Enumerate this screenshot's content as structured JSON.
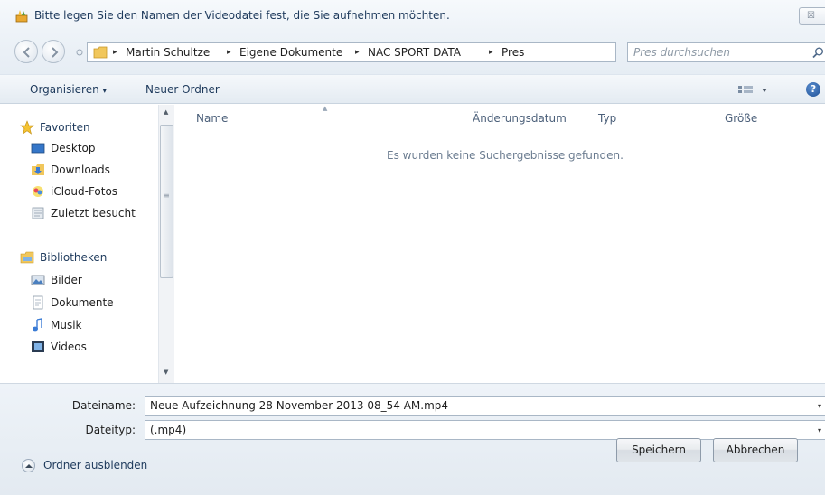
{
  "window": {
    "title": "Bitte legen Sie den Namen der Videodatei fest, die Sie aufnehmen möchten.",
    "close_glyph": "☒"
  },
  "address_bar": {
    "breadcrumbs": [
      "Martin Schultze",
      "Eigene Dokumente",
      "NAC SPORT DATA",
      "Pres"
    ],
    "separator": "▸",
    "dropdown_glyph": "▾",
    "refresh_glyph": "⇆"
  },
  "search": {
    "placeholder": "Pres durchsuchen"
  },
  "toolbar": {
    "organize_label": "Organisieren",
    "organize_caret": "▾",
    "new_folder_label": "Neuer Ordner",
    "help_glyph": "?"
  },
  "nav_pane": {
    "favorites_label": "Favoriten",
    "favorites": [
      {
        "label": "Desktop",
        "icon": "desktop-icon"
      },
      {
        "label": "Downloads",
        "icon": "downloads-icon"
      },
      {
        "label": "iCloud-Fotos",
        "icon": "icloud-photos-icon"
      },
      {
        "label": "Zuletzt besucht",
        "icon": "recent-places-icon"
      }
    ],
    "libraries_label": "Bibliotheken",
    "libraries": [
      {
        "label": "Bilder",
        "icon": "pictures-icon"
      },
      {
        "label": "Dokumente",
        "icon": "documents-icon"
      },
      {
        "label": "Musik",
        "icon": "music-icon"
      },
      {
        "label": "Videos",
        "icon": "videos-icon"
      }
    ]
  },
  "file_list": {
    "columns": [
      "Name",
      "Änderungsdatum",
      "Typ",
      "Größe"
    ],
    "empty_message": "Es wurden keine Suchergebnisse gefunden."
  },
  "form": {
    "filename_label": "Dateiname:",
    "filename_value": "Neue Aufzeichnung 28 November 2013 08_54 AM.mp4",
    "filetype_label": "Dateityp:",
    "filetype_value": "(.mp4)",
    "caret_glyph": "▾"
  },
  "footer": {
    "hide_folders_label": "Ordner ausblenden",
    "save_label": "Speichern",
    "cancel_label": "Abbrechen"
  },
  "colors": {
    "accent": "#1e3a5c",
    "window_bg": "#eef3f8",
    "link_text": "#4c607a"
  }
}
